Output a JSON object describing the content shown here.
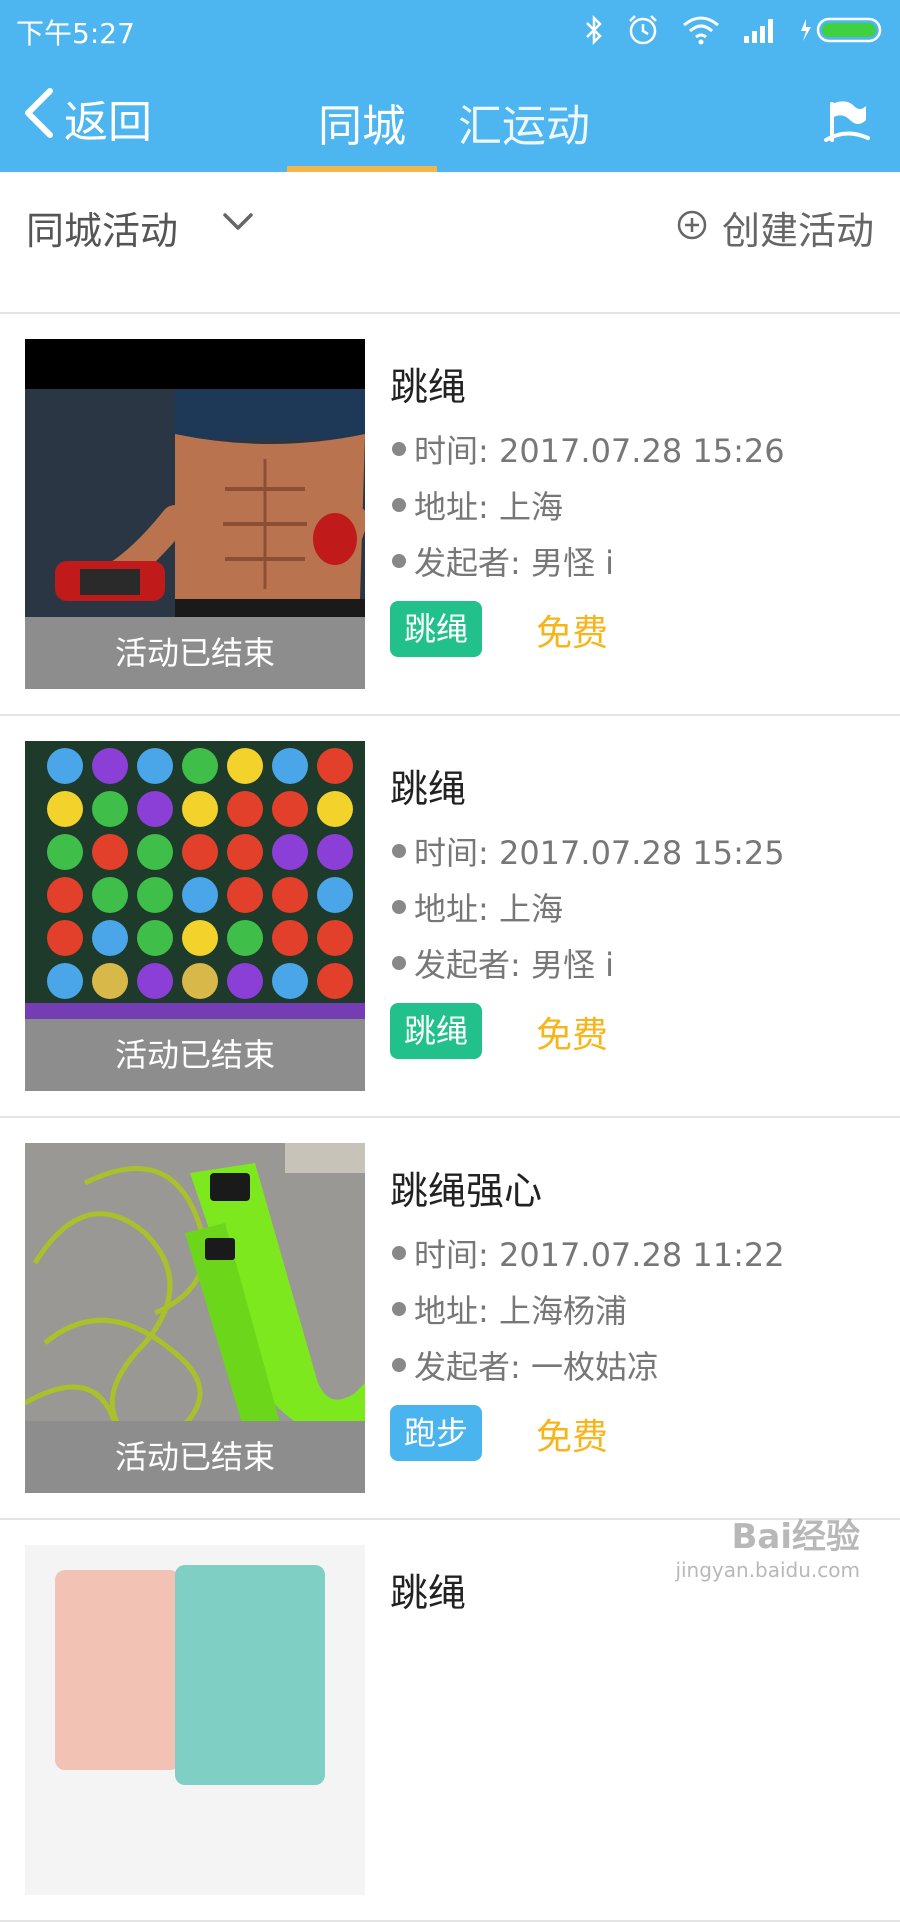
{
  "status_bar": {
    "time": "下午5:27"
  },
  "nav": {
    "back_label": "返回",
    "tabs": [
      {
        "label": "同城"
      },
      {
        "label": "汇运动"
      }
    ]
  },
  "filter": {
    "label": "同城活动",
    "create_label": "创建活动"
  },
  "activities": [
    {
      "title": "跳绳",
      "time": "时间: 2017.07.28 15:26",
      "address": "地址: 上海",
      "organizer": "发起者: 男怪 i",
      "tag": "跳绳",
      "tag_color": "#22c08a",
      "price": "免费",
      "status": "活动已结束",
      "image": "fitness-woman-dumbbells"
    },
    {
      "title": "跳绳",
      "time": "时间: 2017.07.28 15:25",
      "address": "地址: 上海",
      "organizer": "发起者: 男怪 i",
      "tag": "跳绳",
      "tag_color": "#22c08a",
      "price": "免费",
      "status": "活动已结束",
      "image": "match3-game-grid"
    },
    {
      "title": "跳绳强心",
      "time": "时间: 2017.07.28 11:22",
      "address": "地址: 上海杨浦",
      "organizer": "发起者: 一枚姑凉",
      "tag": "跑步",
      "tag_color": "#4ab4ef",
      "price": "免费",
      "status": "活动已结束",
      "image": "green-jump-rope"
    },
    {
      "title": "跳绳",
      "image": "oppo-phone"
    }
  ],
  "watermark": {
    "brand": "Bai经验",
    "url": "jingyan.baidu.com"
  },
  "colors": {
    "header": "#4db6f0",
    "tab_underline": "#f5b54a",
    "price": "#f7b51b"
  }
}
